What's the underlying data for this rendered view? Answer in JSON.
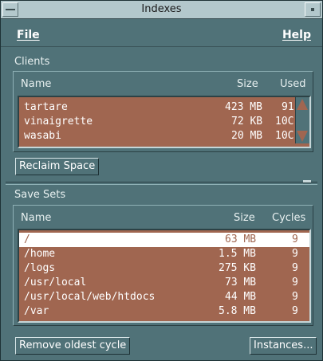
{
  "window": {
    "title": "Indexes"
  },
  "menubar": {
    "file": "File",
    "help": "Help"
  },
  "clients": {
    "label": "Clients",
    "columns": {
      "name": "Name",
      "size": "Size",
      "used": "Used"
    },
    "rows": [
      {
        "name": "tartare",
        "size": "423 MB",
        "used": "91"
      },
      {
        "name": "vinaigrette",
        "size": "72 KB",
        "used": "10C"
      },
      {
        "name": "wasabi",
        "size": "20 MB",
        "used": "10C"
      }
    ],
    "button": "Reclaim Space"
  },
  "savesets": {
    "label": "Save Sets",
    "columns": {
      "name": "Name",
      "size": "Size",
      "cycles": "Cycles"
    },
    "rows": [
      {
        "name": "/",
        "size": "63 MB",
        "cycles": "9"
      },
      {
        "name": "/home",
        "size": "1.5 MB",
        "cycles": "9"
      },
      {
        "name": "/logs",
        "size": "275 KB",
        "cycles": "9"
      },
      {
        "name": "/usr/local",
        "size": "73 MB",
        "cycles": "9"
      },
      {
        "name": "/usr/local/web/htdocs",
        "size": "44 MB",
        "cycles": "9"
      },
      {
        "name": "/var",
        "size": "5.8 MB",
        "cycles": "9"
      }
    ],
    "remove_button": "Remove oldest cycle",
    "instances_button": "Instances..."
  },
  "colors": {
    "background": "#507278",
    "list_bg": "#a06650",
    "title_bg": "#b3c8cc"
  }
}
